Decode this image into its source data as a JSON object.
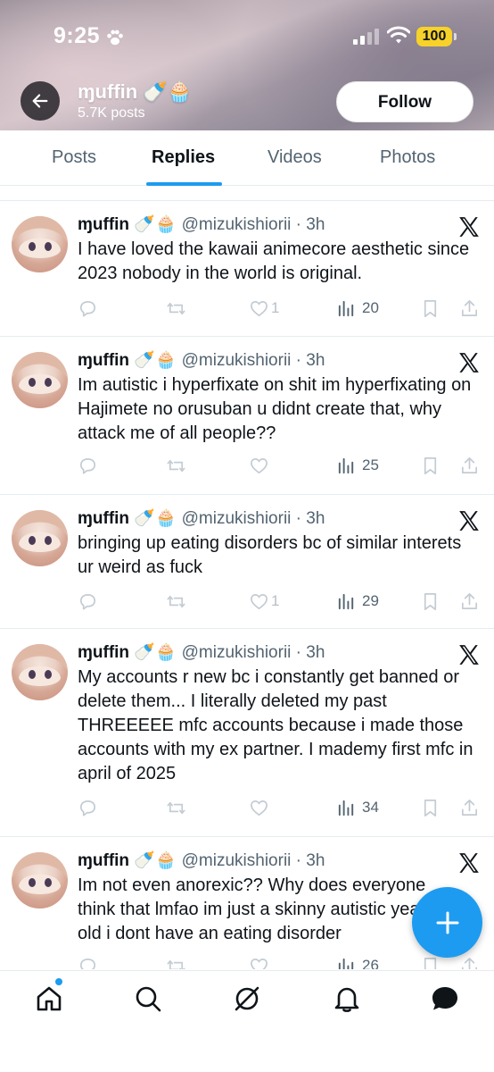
{
  "status_bar": {
    "time": "9:25",
    "battery": "100"
  },
  "profile": {
    "name": "ɱuffin 🍼🧁",
    "posts_count": "5.7K posts",
    "follow_label": "Follow"
  },
  "tabs": [
    {
      "label": "Posts",
      "active": false
    },
    {
      "label": "Replies",
      "active": true
    },
    {
      "label": "Videos",
      "active": false
    },
    {
      "label": "Photos",
      "active": false
    }
  ],
  "posts": [
    {
      "name": "ɱuffin 🍼🧁",
      "handle": "@mizukishiorii · 3h",
      "text": "I have loved the  kawaii animecore aesthetic since 2023 nobody in the world is original.",
      "likes": "1",
      "views": "20"
    },
    {
      "name": "ɱuffin 🍼🧁",
      "handle": "@mizukishiorii · 3h",
      "text": "Im autistic i hyperfixate on shit im hyperfixating on Hajimete no orusuban u didnt create that, why attack me of all people??",
      "likes": "",
      "views": "25"
    },
    {
      "name": "ɱuffin 🍼🧁",
      "handle": "@mizukishiorii · 3h",
      "text": "bringing up eating disorders bc of similar interets ur weird as fuck",
      "likes": "1",
      "views": "29"
    },
    {
      "name": "ɱuffin 🍼🧁",
      "handle": "@mizukishiorii · 3h",
      "text": "My accounts r new bc i constantly get banned or delete them... I literally deleted my past THREEEEE mfc accounts because i made those accounts with my ex partner. I mademy first mfc in april of 2025",
      "likes": "",
      "views": "34"
    },
    {
      "name": "ɱuffin 🍼🧁",
      "handle": "@mizukishiorii · 3h",
      "text": "Im not even anorexic?? Why does everyone think that lmfao im just a skinny autistic year old i dont have an eating disorder",
      "likes": "",
      "views": "26"
    }
  ],
  "icons": {
    "back": "arrow-left-icon",
    "fab": "plus-icon",
    "nav": [
      "home-icon",
      "search-icon",
      "grok-icon",
      "bell-icon",
      "messages-icon"
    ]
  },
  "colors": {
    "accent": "#1d9bf0",
    "text": "#0f1419",
    "muted": "#536471",
    "battery": "#f6d22b"
  }
}
